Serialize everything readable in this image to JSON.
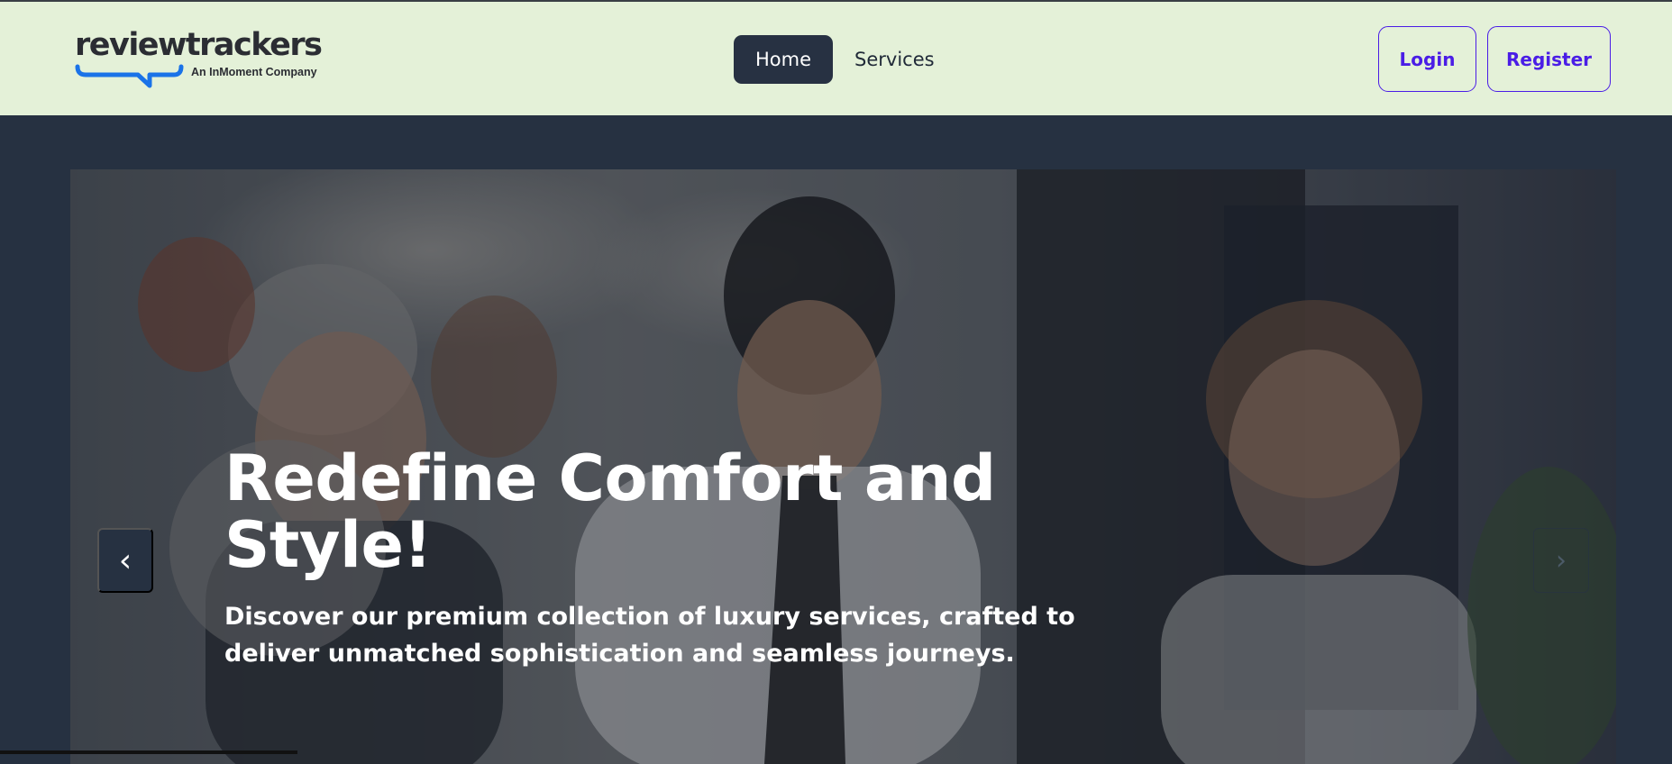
{
  "brand": {
    "name": "reviewtrackers",
    "tagline": "An InMoment Company",
    "accent": "#1a73e8"
  },
  "nav": {
    "items": [
      {
        "label": "Home",
        "active": true
      },
      {
        "label": "Services",
        "active": false
      }
    ]
  },
  "auth": {
    "login_label": "Login",
    "register_label": "Register",
    "color": "#4a1de6"
  },
  "hero": {
    "title": "Redefine Comfort and Style!",
    "description": "Discover our premium collection of luxury services, crafted to deliver unmatched sophistication and seamless journeys.",
    "prev_icon": "‹",
    "next_icon": "›"
  },
  "colors": {
    "header_bg": "#e4f1d8",
    "page_bg": "#263141",
    "active_nav_bg": "#273142"
  }
}
